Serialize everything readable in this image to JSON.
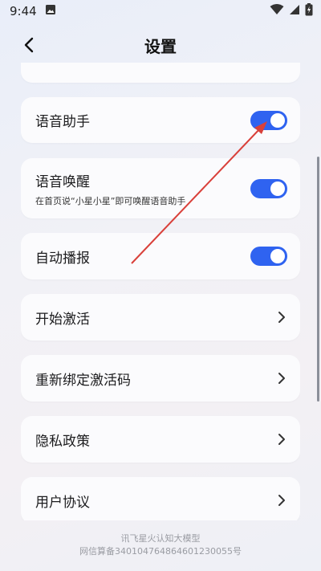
{
  "status_bar": {
    "time": "9:44"
  },
  "header": {
    "title": "设置"
  },
  "settings": [
    {
      "title": "语音助手",
      "control": "toggle",
      "on": true
    },
    {
      "title": "语音唤醒",
      "subtitle": "在首页说“小星小星”即可唤醒语音助手",
      "control": "toggle",
      "on": true
    },
    {
      "title": "自动播报",
      "control": "toggle",
      "on": true
    },
    {
      "title": "开始激活",
      "control": "chevron"
    },
    {
      "title": "重新绑定激活码",
      "control": "chevron"
    },
    {
      "title": "隐私政策",
      "control": "chevron"
    },
    {
      "title": "用户协议",
      "control": "chevron"
    }
  ],
  "footer": {
    "line1": "讯飞星火认知大模型",
    "line2": "网信算备340104764864601230055号"
  },
  "colors": {
    "accent": "#2f63f0",
    "annotation_arrow": "#d9403a"
  }
}
